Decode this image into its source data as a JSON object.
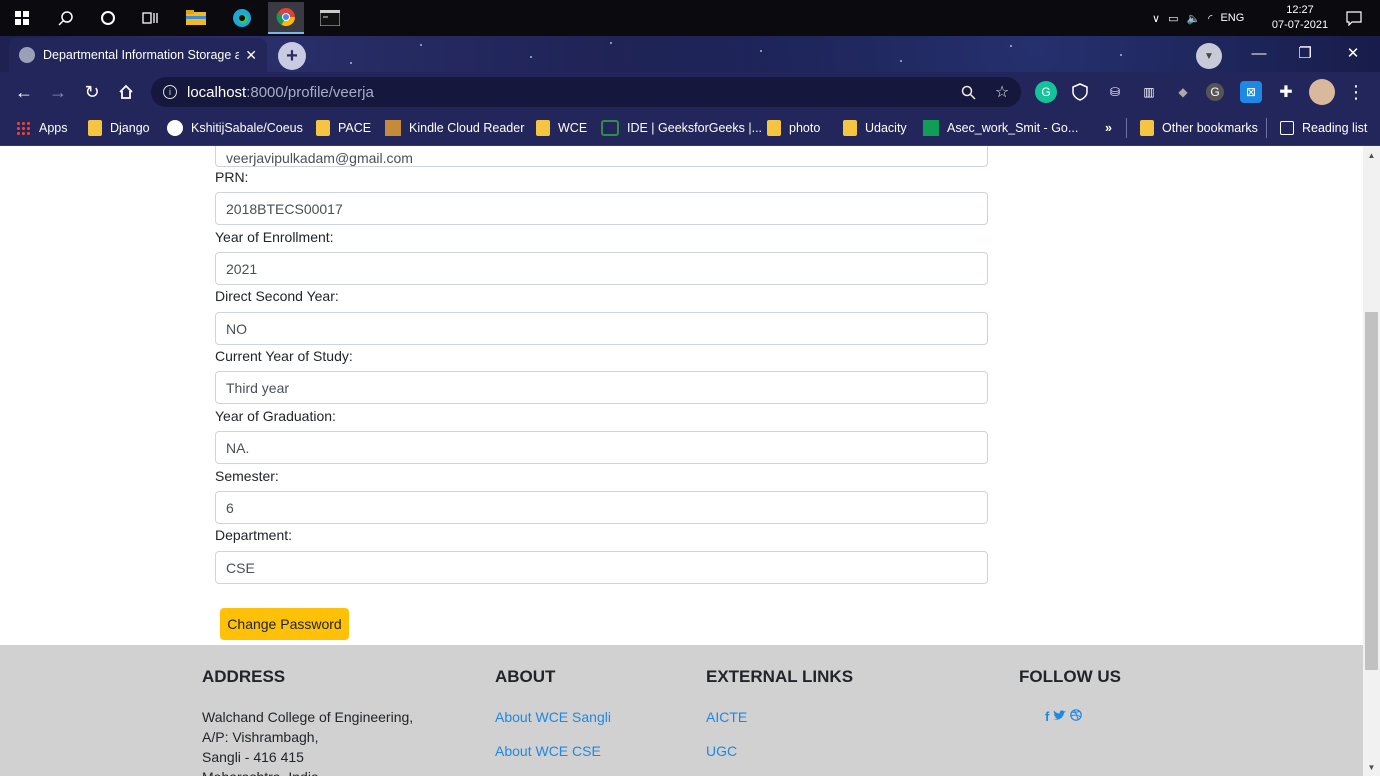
{
  "taskbar": {
    "language": "ENG",
    "time": "12:27",
    "date": "07-07-2021"
  },
  "browser": {
    "tab_title": "Departmental Information Storage a",
    "url_host": "localhost",
    "url_rest": ":8000/profile/veerja",
    "bookmarks": [
      {
        "label": "Apps",
        "icon": "apps-grid-icon"
      },
      {
        "label": "Django",
        "icon": "folder-icon"
      },
      {
        "label": "KshitijSabale/Coeus",
        "icon": "github-icon"
      },
      {
        "label": "PACE",
        "icon": "folder-icon"
      },
      {
        "label": "Kindle Cloud Reader",
        "icon": "kindle-icon"
      },
      {
        "label": "WCE",
        "icon": "folder-icon"
      },
      {
        "label": "IDE | GeeksforGeeks |...",
        "icon": "geeksforgeeks-icon"
      },
      {
        "label": "photo",
        "icon": "folder-icon"
      },
      {
        "label": "Udacity",
        "icon": "folder-icon"
      },
      {
        "label": "Asec_work_Smit - Go...",
        "icon": "sheets-icon"
      }
    ],
    "more_bookmarks": "»",
    "other_bookmarks": "Other bookmarks",
    "reading_list": "Reading list"
  },
  "profile": {
    "email_value": "veerjavipulkadam@gmail.com",
    "fields": [
      {
        "label": "PRN:",
        "value": "2018BTECS00017"
      },
      {
        "label": "Year of Enrollment:",
        "value": "2021"
      },
      {
        "label": "Direct Second Year:",
        "value": "NO"
      },
      {
        "label": "Current Year of Study:",
        "value": "Third year"
      },
      {
        "label": "Year of Graduation:",
        "value": "NA."
      },
      {
        "label": "Semester:",
        "value": "6"
      },
      {
        "label": "Department:",
        "value": "CSE"
      }
    ],
    "change_password_label": "Change Password"
  },
  "footer": {
    "address_heading": "ADDRESS",
    "address_lines": [
      "Walchand College of Engineering,",
      "A/P: Vishrambagh,",
      "Sangli - 416 415",
      "Maharashtra, India"
    ],
    "about_heading": "ABOUT",
    "about_links": [
      "About WCE Sangli",
      "About WCE CSE"
    ],
    "external_heading": "EXTERNAL LINKS",
    "external_links": [
      "AICTE",
      "UGC"
    ],
    "follow_heading": "FOLLOW US",
    "social": [
      "facebook-icon",
      "twitter-icon",
      "dribbble-icon"
    ]
  },
  "colors": {
    "button": "#ffc107",
    "footer_bg": "#d1d1d1",
    "link": "#1e88e5",
    "browser_frame": "#23265a"
  }
}
